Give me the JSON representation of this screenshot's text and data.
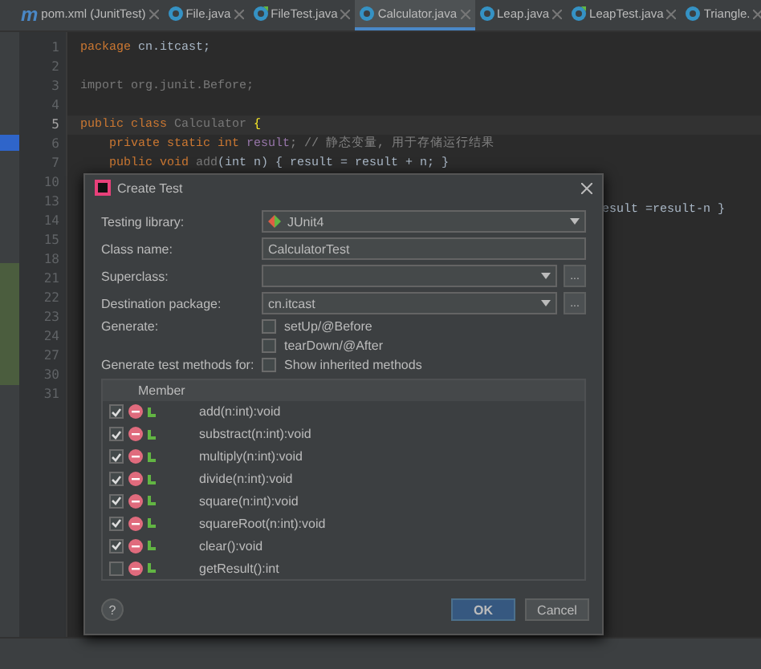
{
  "tabs": [
    {
      "label": "pom.xml (JunitTest)",
      "kind": "maven",
      "glyph": "m",
      "selected": false
    },
    {
      "label": "File.java",
      "kind": "class",
      "selected": false
    },
    {
      "label": "FileTest.java",
      "kind": "test",
      "selected": false
    },
    {
      "label": "Calculator.java",
      "kind": "class",
      "selected": true
    },
    {
      "label": "Leap.java",
      "kind": "class",
      "selected": false
    },
    {
      "label": "LeapTest.java",
      "kind": "test",
      "selected": false
    },
    {
      "label": "Triangle.",
      "kind": "class",
      "selected": false
    }
  ],
  "editor": {
    "lines": [
      {
        "number": "1",
        "tokens": [
          {
            "t": "package ",
            "kind": "kw"
          },
          {
            "t": "cn.itcast;",
            "kind": "plain"
          }
        ]
      },
      {
        "number": "2"
      },
      {
        "number": "3",
        "tokens": [
          {
            "t": "import org.junit.Before;",
            "kind": "unused"
          }
        ]
      },
      {
        "number": "4"
      },
      {
        "number": "5",
        "current": true,
        "tokens": [
          {
            "t": "public class ",
            "kind": "kw"
          },
          {
            "t": "Calculator ",
            "kind": "unused"
          },
          {
            "t": "{",
            "kind": "brace"
          }
        ]
      },
      {
        "number": "6",
        "tokens": [
          {
            "t": "    private static int ",
            "kind": "kw"
          },
          {
            "t": "result",
            "kind": "field"
          },
          {
            "t": "; // 静态变量, 用于存储运行结果",
            "kind": "comment"
          }
        ]
      },
      {
        "number": "7",
        "tokens": [
          {
            "t": "    public void ",
            "kind": "kw"
          },
          {
            "t": "add",
            "kind": "unused"
          },
          {
            "t": "(int n) { result = result + n; }",
            "kind": "plain"
          }
        ]
      }
    ],
    "hidden_line_numbers": [
      "10",
      "13",
      "14",
      "15",
      "18",
      "21",
      "22",
      "23",
      "24",
      "27",
      "30",
      "31"
    ],
    "right_fragment": "esult =result-n }"
  },
  "dialog": {
    "title": "Create Test",
    "testing_library": {
      "label": "Testing library:",
      "value": "JUnit4"
    },
    "class_name": {
      "label": "Class name:",
      "value": "CalculatorTest"
    },
    "superclass": {
      "label": "Superclass:",
      "browse": "..."
    },
    "destination": {
      "label": "Destination package:",
      "value": "cn.itcast",
      "browse": "..."
    },
    "generate": {
      "label": "Generate:",
      "options": [
        {
          "label": "setUp/@Before",
          "checked": false
        },
        {
          "label": "tearDown/@After",
          "checked": false
        }
      ]
    },
    "methods_for": {
      "label": "Generate test methods for:",
      "option": {
        "label": "Show inherited methods",
        "checked": false
      }
    },
    "member_header": "Member",
    "members": [
      {
        "name": "add(n:int):void",
        "checked": true
      },
      {
        "name": "substract(n:int):void",
        "checked": true
      },
      {
        "name": "multiply(n:int):void",
        "checked": true
      },
      {
        "name": "divide(n:int):void",
        "checked": true
      },
      {
        "name": "square(n:int):void",
        "checked": true
      },
      {
        "name": "squareRoot(n:int):void",
        "checked": true
      },
      {
        "name": "clear():void",
        "checked": true
      },
      {
        "name": "getResult():int",
        "checked": false
      }
    ],
    "help": "?",
    "ok": "OK",
    "cancel": "Cancel"
  }
}
